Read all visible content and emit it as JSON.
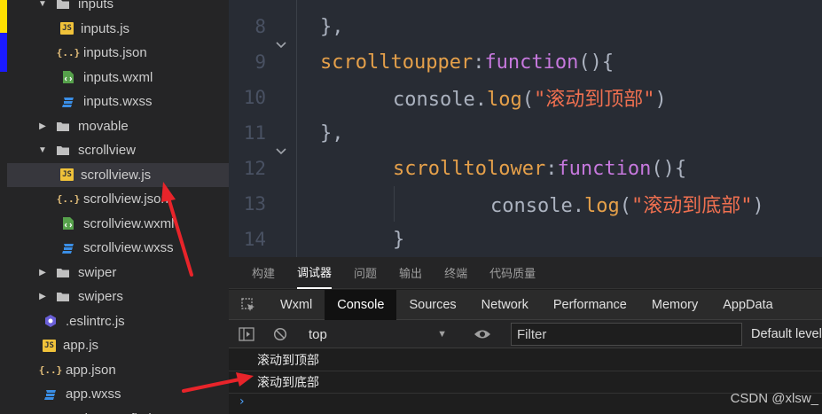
{
  "explorer": {
    "items": [
      {
        "label": "inputs",
        "type": "folder",
        "expanded": true,
        "indent": 0
      },
      {
        "label": "inputs.js",
        "type": "js",
        "indent": 1
      },
      {
        "label": "inputs.json",
        "type": "json",
        "indent": 1
      },
      {
        "label": "inputs.wxml",
        "type": "wxml",
        "indent": 1
      },
      {
        "label": "inputs.wxss",
        "type": "wxss",
        "indent": 1
      },
      {
        "label": "movable",
        "type": "folder",
        "expanded": false,
        "indent": 0
      },
      {
        "label": "scrollview",
        "type": "folder",
        "expanded": true,
        "indent": 0
      },
      {
        "label": "scrollview.js",
        "type": "js",
        "indent": 1,
        "selected": true
      },
      {
        "label": "scrollview.json",
        "type": "json",
        "indent": 1
      },
      {
        "label": "scrollview.wxml",
        "type": "wxml",
        "indent": 1
      },
      {
        "label": "scrollview.wxss",
        "type": "wxss",
        "indent": 1
      },
      {
        "label": "swiper",
        "type": "folder",
        "expanded": false,
        "indent": 0
      },
      {
        "label": "swipers",
        "type": "folder",
        "expanded": false,
        "indent": 0
      },
      {
        "label": ".eslintrc.js",
        "type": "eslint",
        "indent": -1
      },
      {
        "label": "app.js",
        "type": "js",
        "indent": -1
      },
      {
        "label": "app.json",
        "type": "json",
        "indent": -1
      },
      {
        "label": "app.wxss",
        "type": "wxss",
        "indent": -1
      },
      {
        "label": "project.config.json",
        "type": "json",
        "indent": -1
      }
    ]
  },
  "editor": {
    "lines": [
      {
        "num": "8",
        "tokens": [
          {
            "t": "},",
            "c": "punc"
          }
        ]
      },
      {
        "num": "9",
        "fold": true,
        "tokens": [
          {
            "t": "scrolltoupper",
            "c": "prop"
          },
          {
            "t": ":",
            "c": "punc"
          },
          {
            "t": "function",
            "c": "kw"
          },
          {
            "t": "(){",
            "c": "punc"
          }
        ]
      },
      {
        "num": "10",
        "tokens": [
          {
            "t": "console",
            "c": "text"
          },
          {
            "t": ".",
            "c": "punc"
          },
          {
            "t": "log",
            "c": "prop"
          },
          {
            "t": "(",
            "c": "punc"
          },
          {
            "t": "\"滚动到顶部\"",
            "c": "str"
          },
          {
            "t": ")",
            "c": "punc"
          }
        ]
      },
      {
        "num": "11",
        "tokens": [
          {
            "t": "},",
            "c": "punc"
          }
        ]
      },
      {
        "num": "12",
        "fold": true,
        "tokens": [
          {
            "t": "scrolltolower",
            "c": "prop"
          },
          {
            "t": ":",
            "c": "punc"
          },
          {
            "t": "function",
            "c": "kw"
          },
          {
            "t": "(){",
            "c": "punc"
          }
        ]
      },
      {
        "num": "13",
        "tokens": [
          {
            "t": "console",
            "c": "text"
          },
          {
            "t": ".",
            "c": "punc"
          },
          {
            "t": "log",
            "c": "prop"
          },
          {
            "t": "(",
            "c": "punc"
          },
          {
            "t": "\"滚动到底部\"",
            "c": "str"
          },
          {
            "t": ")",
            "c": "punc"
          }
        ]
      },
      {
        "num": "14",
        "tokens": [
          {
            "t": "}",
            "c": "punc"
          }
        ]
      }
    ]
  },
  "devtools": {
    "top_tabs": [
      {
        "label": "构建",
        "active": false
      },
      {
        "label": "调试器",
        "active": true
      },
      {
        "label": "问题",
        "active": false
      },
      {
        "label": "输出",
        "active": false
      },
      {
        "label": "终端",
        "active": false
      },
      {
        "label": "代码质量",
        "active": false
      }
    ],
    "panel_tabs": [
      {
        "label": "Wxml",
        "active": false
      },
      {
        "label": "Console",
        "active": true
      },
      {
        "label": "Sources",
        "active": false
      },
      {
        "label": "Network",
        "active": false
      },
      {
        "label": "Performance",
        "active": false
      },
      {
        "label": "Memory",
        "active": false
      },
      {
        "label": "AppData",
        "active": false
      }
    ],
    "context": "top",
    "filter_placeholder": "Filter",
    "levels_label": "Default levels",
    "logs": [
      "滚动到顶部",
      "滚动到底部"
    ],
    "prompt": "›"
  },
  "watermark": "CSDN @xlsw_",
  "colors": {
    "accent_yellow": "#ffe000",
    "accent_blue": "#1a1aff",
    "arrow_red": "#e8242a"
  }
}
